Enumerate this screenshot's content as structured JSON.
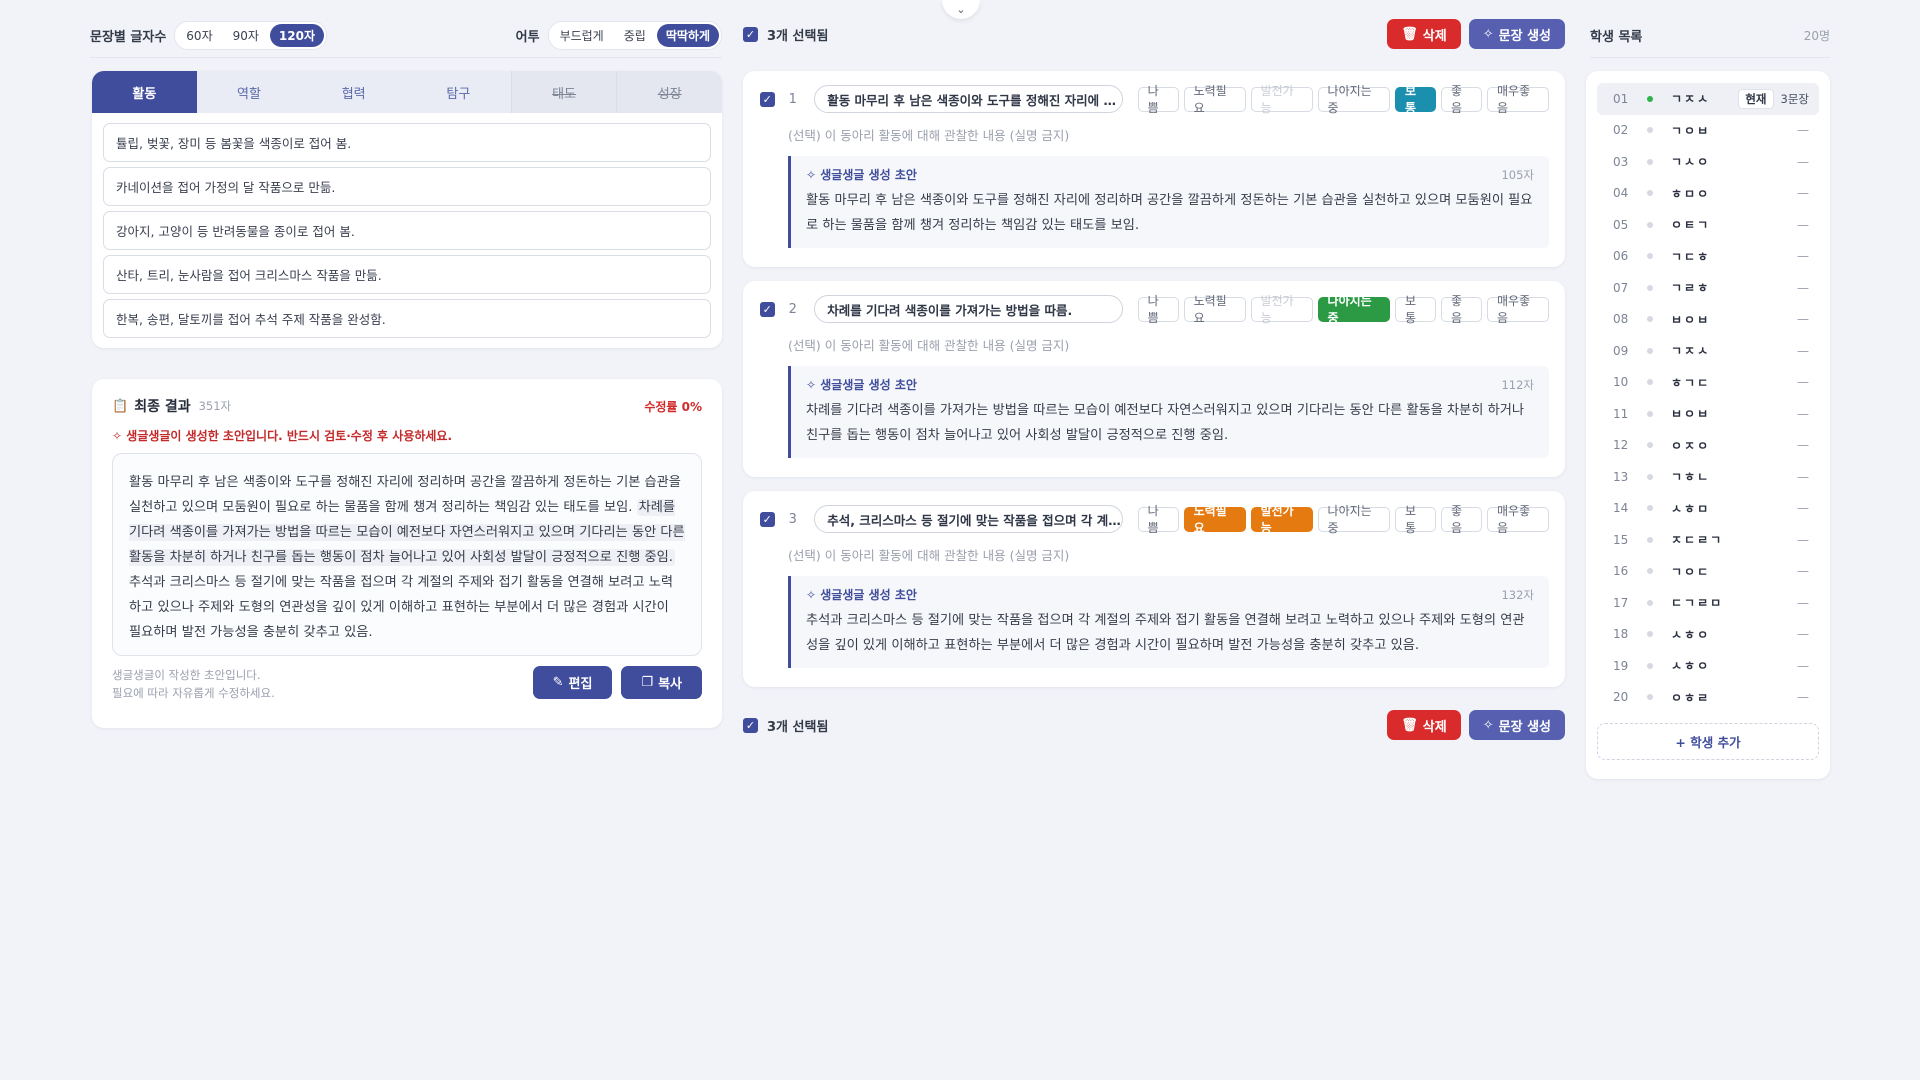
{
  "options": {
    "length_label": "문장별 글자수",
    "length_options": [
      "60자",
      "90자",
      "120자"
    ],
    "length_selected": "120자",
    "tone_label": "어투",
    "tone_options": [
      "부드럽게",
      "중립",
      "딱딱하게"
    ],
    "tone_selected": "딱딱하게"
  },
  "categories": {
    "tabs": [
      {
        "label": "활동",
        "state": "active"
      },
      {
        "label": "역할",
        "state": "normal"
      },
      {
        "label": "협력",
        "state": "normal"
      },
      {
        "label": "탐구",
        "state": "normal"
      },
      {
        "label": "태도",
        "state": "disabled"
      },
      {
        "label": "성장",
        "state": "disabled"
      }
    ],
    "items": [
      "튤립, 벚꽃, 장미 등 봄꽃을 색종이로 접어 봄.",
      "카네이션을 접어 가정의 달 작품으로 만듦.",
      "강아지, 고양이 등 반려동물을 종이로 접어 봄.",
      "산타, 트리, 눈사람을 접어 크리스마스 작품을 만듦.",
      "한복, 송편, 달토끼를 접어 추석 주제 작품을 완성함."
    ]
  },
  "result": {
    "title": "최종 결과",
    "char_count": "351자",
    "edit_rate": "수정률 0%",
    "warning": "생글생글이 생성한 초안입니다. 반드시 검토·수정 후 사용하세요.",
    "text_1": "활동 마무리 후 남은 색종이와 도구를 정해진 자리에 정리하며 공간을 깔끔하게 정돈하는 기본 습관을 실천하고 있으며 모둠원이 필요로 하는 물품을 함께 챙겨 정리하는 책임감 있는 태도를 보임.",
    "text_2": "차례를 기다려 색종이를 가져가는 방법을 따르는 모습이 예전보다 자연스러워지고 있으며 기다리는 동안 다른 활동을 차분히 하거나 친구를 돕는 행동이 점차 늘어나고 있어 사회성 발달이 긍정적으로 진행 중임.",
    "text_3": "추석과 크리스마스 등 절기에 맞는 작품을 접으며 각 계절의 주제와 접기 활동을 연결해 보려고 노력하고 있으나 주제와 도형의 연관성을 깊이 있게 이해하고 표현하는 부분에서 더 많은 경험과 시간이 필요하며 발전 가능성을 충분히 갖추고 있음.",
    "note_1": "생글생글이 작성한 초안입니다.",
    "note_2": "필요에 따라 자유롭게 수정하세요.",
    "edit_label": "편집",
    "copy_label": "복사"
  },
  "selection": {
    "selected_text": "3개 선택됨",
    "delete_label": "삭제",
    "generate_label": "문장 생성"
  },
  "grade_labels": [
    "나쁨",
    "노력필요",
    "발전가능",
    "나아지는중",
    "보통",
    "좋음",
    "매우좋음"
  ],
  "entries": [
    {
      "num": "1",
      "input": "활동 마무리 후 남은 색종이와 도구를 정해진 자리에 …",
      "hint": "(선택) 이 동아리 활동에 대해 관찰한 내용 (실명 금지)",
      "draft_title": "생글생글 생성 초안",
      "draft_count": "105자",
      "draft_text": "활동 마무리 후 남은 색종이와 도구를 정해진 자리에 정리하며 공간을 깔끔하게 정돈하는 기본 습관을 실천하고 있으며 모둠원이 필요로 하는 물품을 함께 챙겨 정리하는 책임감 있는 태도를 보임."
    },
    {
      "num": "2",
      "input": "차례를 기다려 색종이를 가져가는 방법을 따름.",
      "hint": "(선택) 이 동아리 활동에 대해 관찰한 내용 (실명 금지)",
      "draft_title": "생글생글 생성 초안",
      "draft_count": "112자",
      "draft_text": "차례를 기다려 색종이를 가져가는 방법을 따르는 모습이 예전보다 자연스러워지고 있으며 기다리는 동안 다른 활동을 차분히 하거나 친구를 돕는 행동이 점차 늘어나고 있어 사회성 발달이 긍정적으로 진행 중임."
    },
    {
      "num": "3",
      "input": "추석, 크리스마스 등 절기에 맞는 작품을 접으며 각 계…",
      "hint": "(선택) 이 동아리 활동에 대해 관찰한 내용 (실명 금지)",
      "draft_title": "생글생글 생성 초안",
      "draft_count": "132자",
      "draft_text": "추석과 크리스마스 등 절기에 맞는 작품을 접으며 각 계절의 주제와 접기 활동을 연결해 보려고 노력하고 있으나 주제와 도형의 연관성을 깊이 있게 이해하고 표현하는 부분에서 더 많은 경험과 시간이 필요하며 발전 가능성을 충분히 갖추고 있음."
    }
  ],
  "students": {
    "title": "학생 목록",
    "count": "20명",
    "current_label": "현재",
    "current_sentences": "3문장",
    "empty_mark": "—",
    "add_label": "+ 학생 추가",
    "list": [
      {
        "num": "01",
        "name": "ㄱㅈㅅ"
      },
      {
        "num": "02",
        "name": "ㄱㅇㅂ"
      },
      {
        "num": "03",
        "name": "ㄱㅅㅇ"
      },
      {
        "num": "04",
        "name": "ㅎㅁㅇ"
      },
      {
        "num": "05",
        "name": "ㅇㅌㄱ"
      },
      {
        "num": "06",
        "name": "ㄱㄷㅎ"
      },
      {
        "num": "07",
        "name": "ㄱㄹㅎ"
      },
      {
        "num": "08",
        "name": "ㅂㅇㅂ"
      },
      {
        "num": "09",
        "name": "ㄱㅈㅅ"
      },
      {
        "num": "10",
        "name": "ㅎㄱㄷ"
      },
      {
        "num": "11",
        "name": "ㅂㅇㅂ"
      },
      {
        "num": "12",
        "name": "ㅇㅈㅇ"
      },
      {
        "num": "13",
        "name": "ㄱㅎㄴ"
      },
      {
        "num": "14",
        "name": "ㅅㅎㅁ"
      },
      {
        "num": "15",
        "name": "ㅈㄷㄹㄱ"
      },
      {
        "num": "16",
        "name": "ㄱㅇㄷ"
      },
      {
        "num": "17",
        "name": "ㄷㄱㄹㅁ"
      },
      {
        "num": "18",
        "name": "ㅅㅎㅇ"
      },
      {
        "num": "19",
        "name": "ㅅㅎㅇ"
      },
      {
        "num": "20",
        "name": "ㅇㅎㄹ"
      }
    ]
  }
}
